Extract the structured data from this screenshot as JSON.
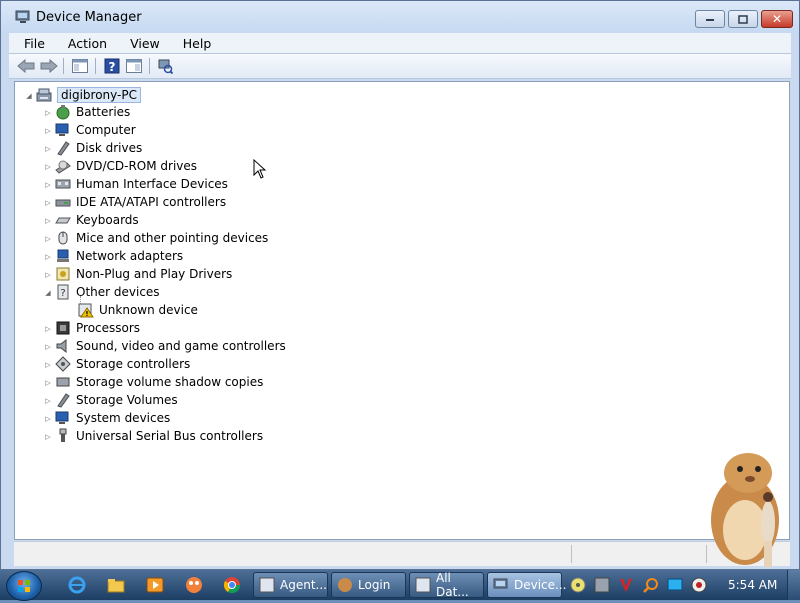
{
  "window": {
    "title": "Device Manager",
    "menu": [
      "File",
      "Action",
      "View",
      "Help"
    ]
  },
  "tree": {
    "root": "digibrony-PC",
    "categories": [
      "Batteries",
      "Computer",
      "Disk drives",
      "DVD/CD-ROM drives",
      "Human Interface Devices",
      "IDE ATA/ATAPI controllers",
      "Keyboards",
      "Mice and other pointing devices",
      "Network adapters",
      "Non-Plug and Play Drivers",
      "Other devices",
      "Processors",
      "Sound, video and game controllers",
      "Storage controllers",
      "Storage volume shadow copies",
      "Storage Volumes",
      "System devices",
      "Universal Serial Bus controllers"
    ],
    "other_devices_child": "Unknown device"
  },
  "taskbar": {
    "tasks": [
      "Agent...",
      "Login",
      "All Dat...",
      "Device..."
    ],
    "clock": "5:54 AM"
  },
  "colors": {
    "accent": "#1d5fa6",
    "title_bar": "#c9daf0",
    "warning": "#f2c200"
  }
}
